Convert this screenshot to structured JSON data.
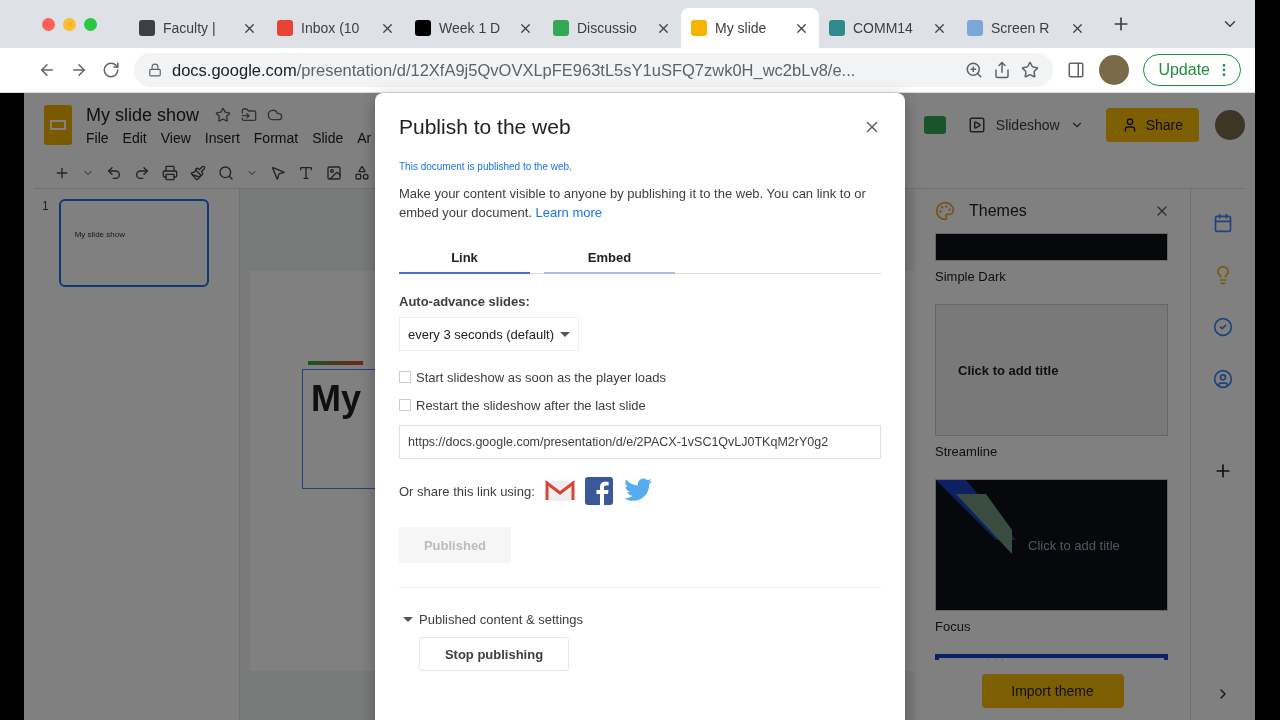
{
  "browser": {
    "tabs": [
      {
        "title": "Faculty |",
        "selected": false,
        "color": "#3c4043"
      },
      {
        "title": "Inbox (10",
        "selected": false,
        "color": "#ea4335"
      },
      {
        "title": "Week 1 D",
        "selected": false,
        "color": "#000000"
      },
      {
        "title": "Discussio",
        "selected": false,
        "color": "#34a853"
      },
      {
        "title": "My slide",
        "selected": true,
        "color": "#f4b400"
      },
      {
        "title": "COMM14",
        "selected": false,
        "color": "#2e8b8b"
      },
      {
        "title": "Screen R",
        "selected": false,
        "color": "#7aa7d8"
      }
    ],
    "url": {
      "host": "docs.google.com",
      "path": "/presentation/d/12XfA9j5QvOVXLpFE963tL5sY1uSFQ7zwk0H_wc2bLv8/e..."
    },
    "update_button": "Update"
  },
  "docs": {
    "title": "My slide show",
    "menus": [
      "File",
      "Edit",
      "View",
      "Insert",
      "Format",
      "Slide",
      "Ar"
    ],
    "slideshow_button": "Slideshow",
    "share_button": "Share"
  },
  "filmstrip": [
    {
      "number": "1",
      "title": "My slide show",
      "selected": true
    }
  ],
  "slide": {
    "title": "My"
  },
  "themes": {
    "title": "Themes",
    "items": [
      {
        "kind": "strip",
        "name": "Simple Dark"
      },
      {
        "kind": "light",
        "name": "Streamline",
        "preview_title": "Click to add title"
      },
      {
        "kind": "dark",
        "name": "Focus",
        "preview_title": "Click to add title"
      },
      {
        "kind": "frame"
      }
    ],
    "import_button": "Import theme"
  },
  "dialog": {
    "title": "Publish to the web",
    "status": "This document is published to the web.",
    "description": "Make your content visible to anyone by publishing it to the web. You can link to or embed your document.",
    "learn_more": "Learn more",
    "tabs": [
      {
        "label": "Link",
        "selected": true
      },
      {
        "label": "Embed",
        "selected": false
      }
    ],
    "auto_advance_label": "Auto-advance slides:",
    "auto_advance_value": "every 3 seconds (default)",
    "options": [
      {
        "label": "Start slideshow as soon as the player loads",
        "checked": false
      },
      {
        "label": "Restart the slideshow after the last slide",
        "checked": false
      }
    ],
    "link": "https://docs.google.com/presentation/d/e/2PACX-1vSC1QvLJ0TKqM2rY0g2",
    "share_label": "Or share this link using:",
    "publish_button": {
      "label": "Published",
      "disabled": true
    },
    "section": {
      "label": "Published content & settings",
      "expanded": true
    },
    "stop_button": "Stop publishing"
  }
}
